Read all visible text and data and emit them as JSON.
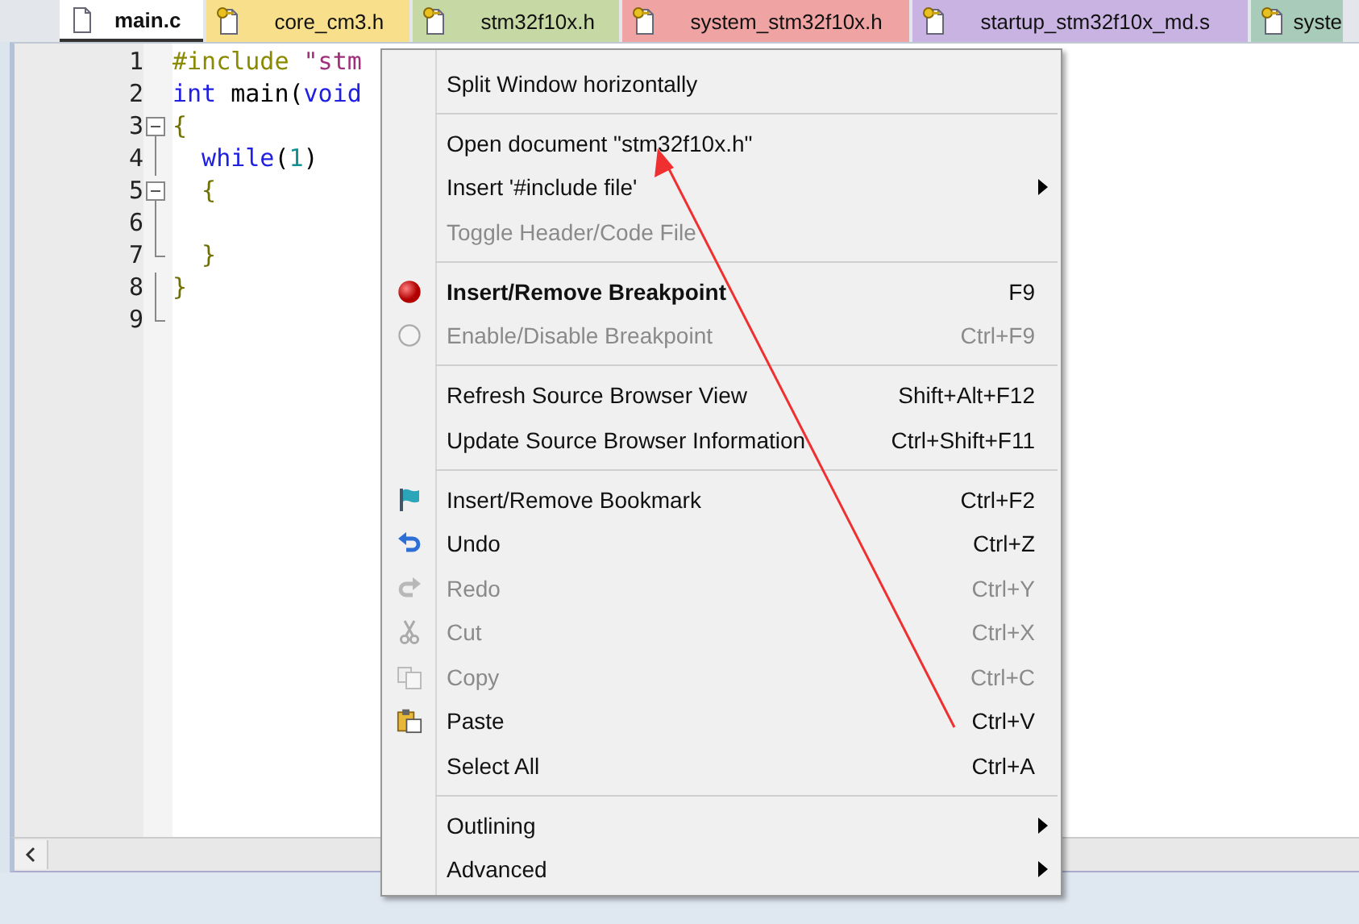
{
  "tabs": [
    {
      "label": "main.c",
      "selected": true,
      "color": "#ffffff"
    },
    {
      "label": "core_cm3.h",
      "selected": false,
      "color": "#f7df8c"
    },
    {
      "label": "stm32f10x.h",
      "selected": false,
      "color": "#c6d9a4"
    },
    {
      "label": "system_stm32f10x.h",
      "selected": false,
      "color": "#efa3a3"
    },
    {
      "label": "startup_stm32f10x_md.s",
      "selected": false,
      "color": "#c9b3e2"
    },
    {
      "label": "syste",
      "selected": false,
      "color": "#a9cbb9"
    }
  ],
  "editor": {
    "lines": [
      {
        "number": "1",
        "fold_start": false,
        "fold_end": false,
        "tokens": [
          {
            "kind": "preprocessor",
            "text": "#include "
          },
          {
            "kind": "string",
            "text": "\"stm"
          }
        ]
      },
      {
        "number": "2",
        "fold_start": false,
        "fold_end": false,
        "tokens": [
          {
            "kind": "keyword",
            "text": "int"
          },
          {
            "kind": "plain",
            "text": " main("
          },
          {
            "kind": "keyword",
            "text": "void"
          }
        ]
      },
      {
        "number": "3",
        "fold_start": true,
        "fold_end": false,
        "tokens": [
          {
            "kind": "brace",
            "text": "{"
          }
        ]
      },
      {
        "number": "4",
        "fold_start": false,
        "fold_end": false,
        "tokens": [
          {
            "kind": "keyword",
            "text": "  while"
          },
          {
            "kind": "plain",
            "text": "("
          },
          {
            "kind": "number",
            "text": "1"
          },
          {
            "kind": "plain",
            "text": ")"
          }
        ]
      },
      {
        "number": "5",
        "fold_start": true,
        "fold_end": false,
        "tokens": [
          {
            "kind": "brace",
            "text": "  {"
          }
        ]
      },
      {
        "number": "6",
        "fold_start": false,
        "fold_end": false
      },
      {
        "number": "7",
        "fold_start": false,
        "fold_end": true,
        "tokens": [
          {
            "kind": "brace",
            "text": "  }"
          }
        ]
      },
      {
        "number": "8",
        "fold_start": false,
        "fold_end": false,
        "tokens": [
          {
            "kind": "brace",
            "text": "}"
          }
        ]
      },
      {
        "number": "9",
        "fold_start": false,
        "fold_end": true
      }
    ]
  },
  "context_menu": {
    "items": [
      {
        "kind": "item",
        "label": "Split Window horizontally",
        "disabled": false,
        "bold": false,
        "submenu": false
      },
      {
        "kind": "separator"
      },
      {
        "kind": "item",
        "label": "Open document \"stm32f10x.h\"",
        "disabled": false,
        "bold": false,
        "submenu": false
      },
      {
        "kind": "item",
        "label": "Insert '#include file'",
        "disabled": false,
        "bold": false,
        "submenu": true
      },
      {
        "kind": "item",
        "label": "Toggle Header/Code File",
        "disabled": true,
        "bold": false,
        "submenu": false
      },
      {
        "kind": "separator"
      },
      {
        "kind": "item",
        "label": "Insert/Remove Breakpoint",
        "shortcut": "F9",
        "disabled": false,
        "bold": true,
        "submenu": false
      },
      {
        "kind": "item",
        "label": "Enable/Disable Breakpoint",
        "shortcut": "Ctrl+F9",
        "disabled": true,
        "bold": false,
        "submenu": false
      },
      {
        "kind": "separator"
      },
      {
        "kind": "item",
        "label": "Refresh Source Browser View",
        "shortcut": "Shift+Alt+F12",
        "disabled": false,
        "bold": false,
        "submenu": false
      },
      {
        "kind": "item",
        "label": "Update Source Browser Information",
        "shortcut": "Ctrl+Shift+F11",
        "disabled": false,
        "bold": false,
        "submenu": false
      },
      {
        "kind": "separator"
      },
      {
        "kind": "item",
        "label": "Insert/Remove Bookmark",
        "shortcut": "Ctrl+F2",
        "disabled": false,
        "bold": false,
        "submenu": false
      },
      {
        "kind": "item",
        "label": "Undo",
        "shortcut": "Ctrl+Z",
        "disabled": false,
        "bold": false,
        "submenu": false
      },
      {
        "kind": "item",
        "label": "Redo",
        "shortcut": "Ctrl+Y",
        "disabled": true,
        "bold": false,
        "submenu": false
      },
      {
        "kind": "item",
        "label": "Cut",
        "shortcut": "Ctrl+X",
        "disabled": true,
        "bold": false,
        "submenu": false
      },
      {
        "kind": "item",
        "label": "Copy",
        "shortcut": "Ctrl+C",
        "disabled": true,
        "bold": false,
        "submenu": false
      },
      {
        "kind": "item",
        "label": "Paste",
        "shortcut": "Ctrl+V",
        "disabled": false,
        "bold": false,
        "submenu": false
      },
      {
        "kind": "item",
        "label": "Select All",
        "shortcut": "Ctrl+A",
        "disabled": false,
        "bold": false,
        "submenu": false
      },
      {
        "kind": "separator"
      },
      {
        "kind": "item",
        "label": "Outlining",
        "disabled": false,
        "bold": false,
        "submenu": true
      },
      {
        "kind": "item",
        "label": "Advanced",
        "disabled": false,
        "bold": false,
        "submenu": true
      }
    ]
  }
}
